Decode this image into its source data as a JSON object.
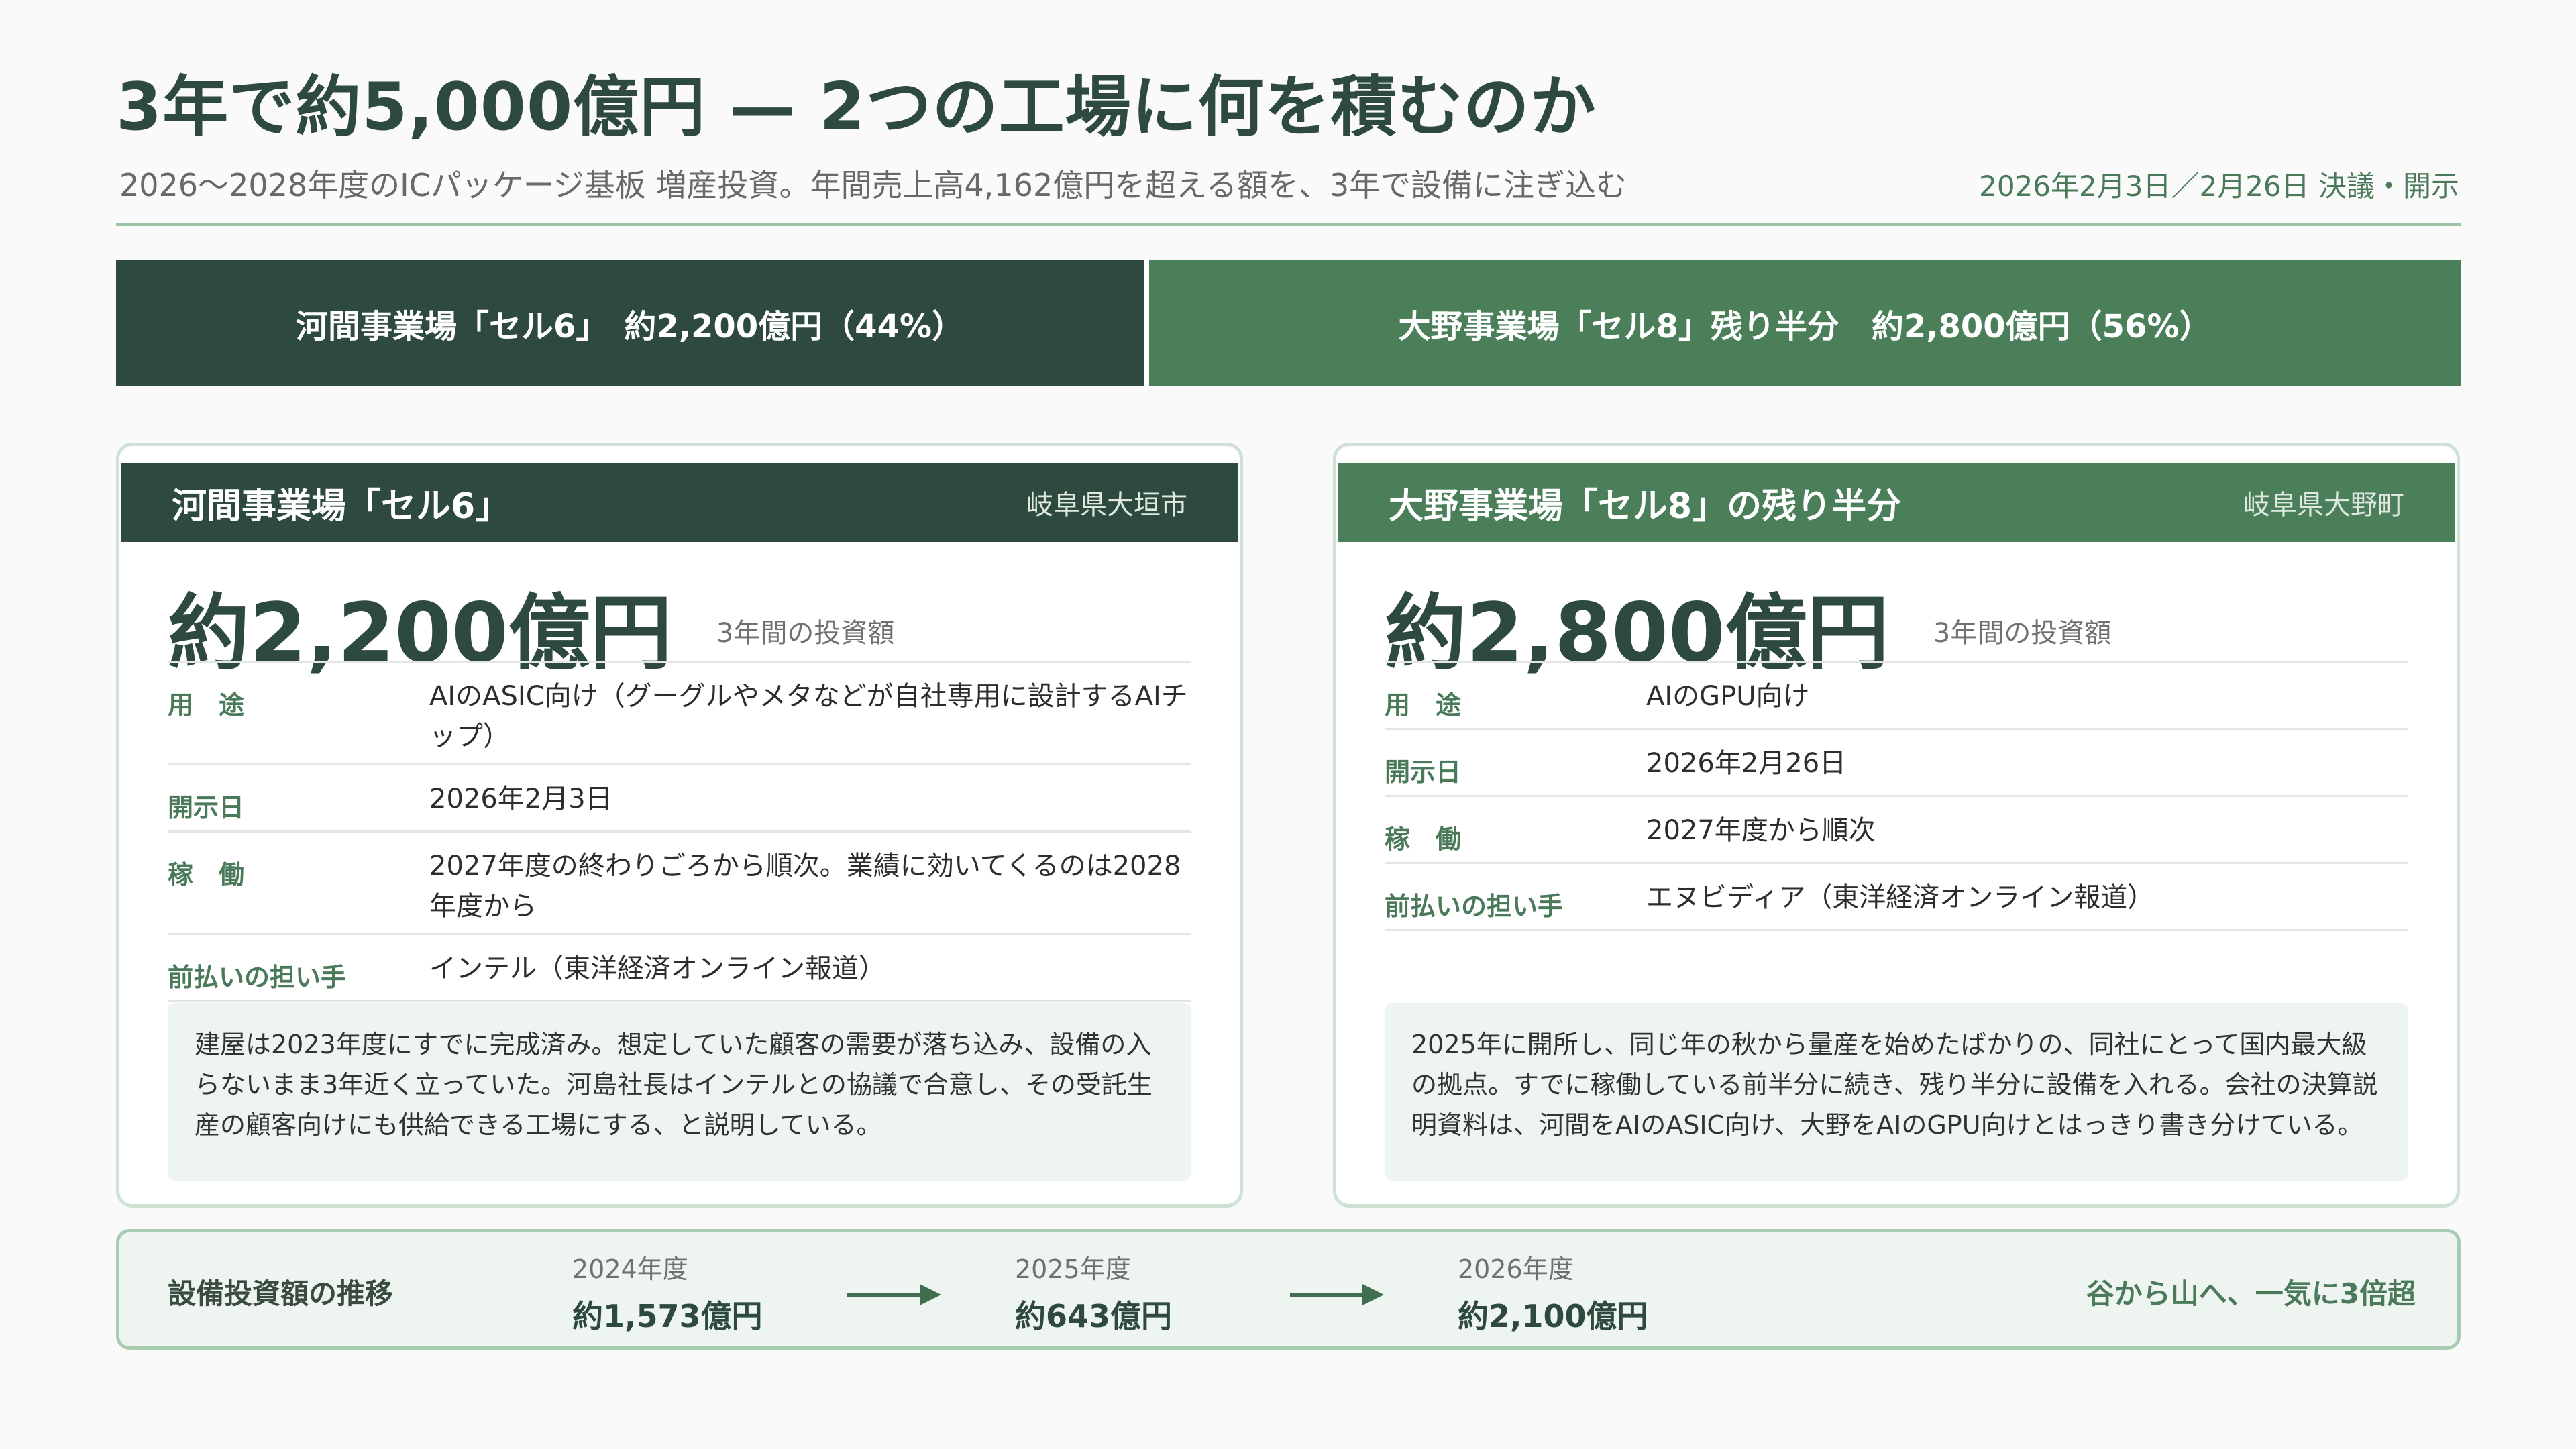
{
  "header": {
    "title": "3年で約5,000億円 — 2つの工場に何を積むのか",
    "subtitle": "2026〜2028年度のICパッケージ基板 増産投資。年間売上高4,162億円を超える額を、3年で設備に注ぎ込む",
    "dateline": "2026年2月3日／2月26日 決議・開示"
  },
  "split": {
    "a_label": "河間事業場「セル6」　約2,200億円（44%）",
    "b_label": "大野事業場「セル8」残り半分　約2,800億円（56%）",
    "a_share": 44,
    "b_share": 56
  },
  "cards": [
    {
      "name": "河間事業場「セル6」",
      "location": "岐阜県大垣市",
      "amount": "約2,200億円",
      "amount_label": "3年間の投資額",
      "rows": [
        {
          "label": "用　途",
          "value": "AIのASIC向け（グーグルやメタなどが自社専用に設計するAIチップ）"
        },
        {
          "label": "開示日",
          "value": "2026年2月3日"
        },
        {
          "label": "稼　働",
          "value": "2027年度の終わりごろから順次。業績に効いてくるのは2028年度から"
        },
        {
          "label": "前払いの担い手",
          "value": "インテル（東洋経済オンライン報道）"
        }
      ],
      "note": "建屋は2023年度にすでに完成済み。想定していた顧客の需要が落ち込み、設備の入らないまま3年近く立っていた。河島社長はインテルとの協議で合意し、その受託生産の顧客向けにも供給できる工場にする、と説明している。"
    },
    {
      "name": "大野事業場「セル8」の残り半分",
      "location": "岐阜県大野町",
      "amount": "約2,800億円",
      "amount_label": "3年間の投資額",
      "rows": [
        {
          "label": "用　途",
          "value": "AIのGPU向け"
        },
        {
          "label": "開示日",
          "value": "2026年2月26日"
        },
        {
          "label": "稼　働",
          "value": "2027年度から順次"
        },
        {
          "label": "前払いの担い手",
          "value": "エヌビディア（東洋経済オンライン報道）"
        }
      ],
      "note": "2025年に開所し、同じ年の秋から量産を始めたばかりの、同社にとって国内最大級の拠点。すでに稼働している前半分に続き、残り半分に設備を入れる。会社の決算説明資料は、河間をAIのASIC向け、大野をAIのGPU向けとはっきり書き分けている。"
    }
  ],
  "trend": {
    "title": "設備投資額の推移",
    "items": [
      {
        "year": "2024年度",
        "value": "約1,573億円"
      },
      {
        "year": "2025年度",
        "value": "約643億円"
      },
      {
        "year": "2026年度",
        "value": "約2,100億円"
      }
    ],
    "punchline": "谷から山へ、一気に3倍超"
  },
  "colors": {
    "dark_green": "#2e4a3e",
    "mid_green": "#4a7f5a",
    "accent_green": "#4a7a5a",
    "light_bg": "#eef4f0"
  }
}
